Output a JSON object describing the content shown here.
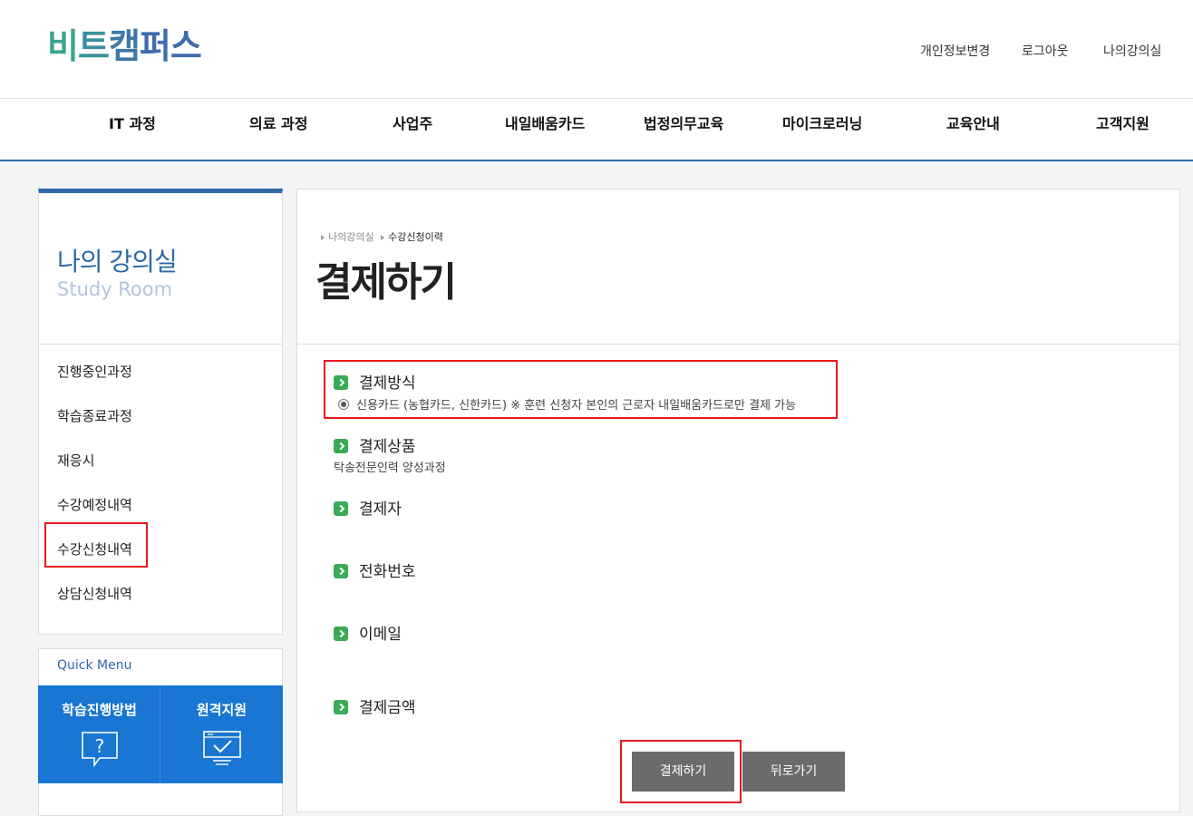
{
  "logo": {
    "text": [
      "비",
      "트",
      "캠",
      "퍼스"
    ]
  },
  "util": [
    "개인정보변경",
    "로그아웃",
    "나의강의실"
  ],
  "gnb": [
    "IT 과정",
    "의료 과정",
    "사업주",
    "내일배움카드",
    "법정의무교육",
    "마이크로러닝",
    "교육안내",
    "고객지원"
  ],
  "sidebar": {
    "title": "나의 강의실",
    "subtitle": "Study Room",
    "items": [
      "진행중인과정",
      "학습종료과정",
      "재응시",
      "수강예정내역",
      "수강신청내역",
      "상담신청내역"
    ]
  },
  "quick": {
    "title": "Quick Menu",
    "buttons": [
      "학습진행방법",
      "원격지원"
    ]
  },
  "breadcrumb": [
    "나의강의실",
    "수강신청이력"
  ],
  "page_title": "결제하기",
  "sections": {
    "method": {
      "label": "결제방식",
      "option": "신용카드 (농협카드, 신한카드) ※ 훈련 신청자 본인의 근로자 내일배움카드로만 결제 가능"
    },
    "product": {
      "label": "결제상품",
      "value": "탁송전문인력 양성과정"
    },
    "payer": {
      "label": "결제자"
    },
    "phone": {
      "label": "전화번호"
    },
    "email": {
      "label": "이메일"
    },
    "amount": {
      "label": "결제금액"
    }
  },
  "buttons": {
    "pay": "결제하기",
    "back": "뒤로가기"
  },
  "colors": {
    "accent": "#2f69a8",
    "quick_bg": "#1976d2",
    "highlight": "#e8181c",
    "button_bg": "#6b6b6b",
    "section_icon": "#3aab55"
  }
}
